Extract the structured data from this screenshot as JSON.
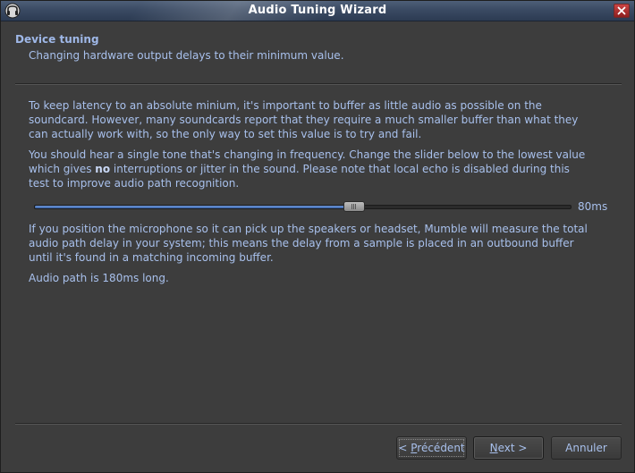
{
  "window": {
    "title": "Audio Tuning Wizard"
  },
  "page": {
    "title": "Device tuning",
    "subtitle": "Changing hardware output delays to their minimum value."
  },
  "paragraphs": {
    "p1": "To keep latency to an absolute minium, it's important to buffer as little audio as possible on the soundcard. However, many soundcards report that they require a much smaller buffer than what they can actually work with, so the only way to set this value is to try and fail.",
    "p2_pre": "You should hear a single tone that's changing in frequency. Change the slider below to the lowest value which gives ",
    "p2_bold": "no",
    "p2_post": " interruptions or jitter in the sound. Please note that local echo is disabled during this test to improve audio path recognition.",
    "p3": "If you position the microphone so it can pick up the speakers or headset, Mumble will measure the total audio path delay in your system; this means the delay from a sample is placed in an outbound buffer until it's found in a matching incoming buffer.",
    "p4": "Audio path is 180ms long."
  },
  "slider": {
    "value_label": "80ms",
    "position_fraction": 0.595
  },
  "buttons": {
    "back_label_prefix": "< ",
    "back_label_mnemonic": "P",
    "back_label_rest": "récédent",
    "next_label_mnemonic": "N",
    "next_label_rest": "ext >",
    "cancel_label": "Annuler"
  },
  "colors": {
    "accent_text": "#a8c0ec",
    "slider_fill": "#4f7bc4",
    "background": "#3d3d3d"
  },
  "icons": {
    "app": "mumble-logo-icon",
    "close": "close-icon",
    "grip": "slider-grip-icon"
  }
}
